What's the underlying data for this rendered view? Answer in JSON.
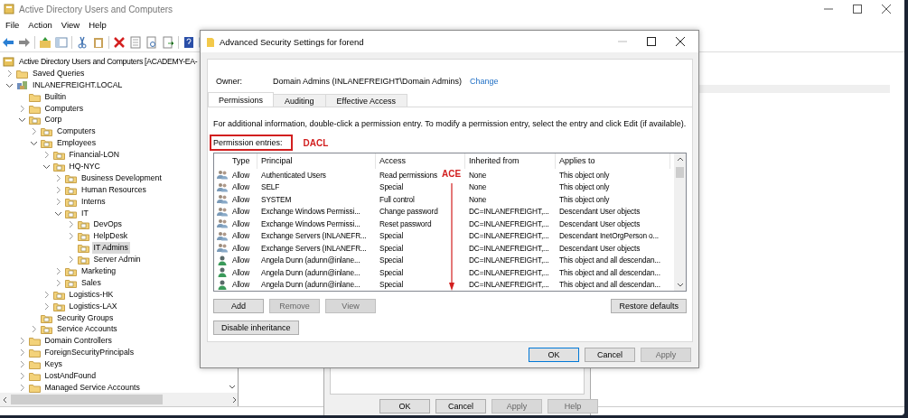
{
  "main_window": {
    "title": "Active Directory Users and Computers",
    "menu": [
      "File",
      "Action",
      "View",
      "Help"
    ],
    "tree": [
      {
        "kind": "root",
        "label": "Active Directory Users and Computers [ACADEMY-EA-",
        "selected": false,
        "children": [
          {
            "kind": "container",
            "label": "Saved Queries",
            "expanded": false,
            "selected": false
          },
          {
            "kind": "domain",
            "label": "INLANEFREIGHT.LOCAL",
            "expanded": true,
            "selected": false,
            "children": [
              {
                "kind": "container",
                "label": "Builtin",
                "selected": false
              },
              {
                "kind": "container",
                "label": "Computers",
                "expanded": false,
                "selected": false
              },
              {
                "kind": "ou",
                "label": "Corp",
                "expanded": true,
                "selected": false,
                "children": [
                  {
                    "kind": "ou",
                    "label": "Computers",
                    "expanded": false,
                    "selected": false
                  },
                  {
                    "kind": "ou",
                    "label": "Employees",
                    "expanded": true,
                    "selected": false,
                    "children": [
                      {
                        "kind": "ou",
                        "label": "Financial-LON",
                        "expanded": false,
                        "selected": false
                      },
                      {
                        "kind": "ou",
                        "label": "HQ-NYC",
                        "expanded": true,
                        "selected": false,
                        "children": [
                          {
                            "kind": "ou",
                            "label": "Business Development",
                            "expanded": false,
                            "selected": false
                          },
                          {
                            "kind": "ou",
                            "label": "Human Resources",
                            "expanded": false,
                            "selected": false
                          },
                          {
                            "kind": "ou",
                            "label": "Interns",
                            "expanded": false,
                            "selected": false
                          },
                          {
                            "kind": "ou",
                            "label": "IT",
                            "expanded": true,
                            "selected": false,
                            "children": [
                              {
                                "kind": "ou",
                                "label": "DevOps",
                                "expanded": false,
                                "selected": false
                              },
                              {
                                "kind": "ou",
                                "label": "HelpDesk",
                                "expanded": false,
                                "selected": false
                              },
                              {
                                "kind": "ou",
                                "label": "IT Admins",
                                "selected": true
                              },
                              {
                                "kind": "ou",
                                "label": "Server Admin",
                                "expanded": false,
                                "selected": false
                              }
                            ]
                          },
                          {
                            "kind": "ou",
                            "label": "Marketing",
                            "expanded": false,
                            "selected": false
                          },
                          {
                            "kind": "ou",
                            "label": "Sales",
                            "expanded": false,
                            "selected": false
                          }
                        ]
                      },
                      {
                        "kind": "ou",
                        "label": "Logistics-HK",
                        "expanded": false,
                        "selected": false
                      },
                      {
                        "kind": "ou",
                        "label": "Logistics-LAX",
                        "expanded": false,
                        "selected": false
                      }
                    ]
                  },
                  {
                    "kind": "ou",
                    "label": "Security Groups",
                    "selected": false
                  },
                  {
                    "kind": "ou",
                    "label": "Service Accounts",
                    "expanded": false,
                    "selected": false
                  }
                ]
              },
              {
                "kind": "container",
                "label": "Domain Controllers",
                "expanded": false,
                "selected": false
              },
              {
                "kind": "container",
                "label": "ForeignSecurityPrincipals",
                "expanded": false,
                "selected": false
              },
              {
                "kind": "container",
                "label": "Keys",
                "expanded": false,
                "selected": false
              },
              {
                "kind": "container",
                "label": "LostAndFound",
                "expanded": false,
                "selected": false
              },
              {
                "kind": "container",
                "label": "Managed Service Accounts",
                "expanded": false,
                "selected": false
              }
            ]
          }
        ]
      }
    ]
  },
  "properties_dialog": {
    "buttons": [
      {
        "label": "OK",
        "disabled": false
      },
      {
        "label": "Cancel",
        "disabled": false
      },
      {
        "label": "Apply",
        "disabled": true
      },
      {
        "label": "Help",
        "disabled": true
      }
    ]
  },
  "dialog": {
    "title": "Advanced Security Settings for forend",
    "owner_label": "Owner:",
    "owner": "Domain Admins (INLANEFREIGHT\\Domain Admins)",
    "owner_link": "Change",
    "tabs": [
      {
        "label": "Permissions",
        "selected": true
      },
      {
        "label": "Auditing",
        "selected": false
      },
      {
        "label": "Effective Access",
        "selected": false
      }
    ],
    "info": "For additional information, double-click a permission entry. To modify a permission entry, select the entry and click Edit (if available).",
    "entries_label": "Permission entries:",
    "entries_label_highlighted": true,
    "dacl_annotation": "DACL",
    "ace_annotation": "ACE",
    "columns": [
      "Type",
      "Principal",
      "Access",
      "Inherited from",
      "Applies to"
    ],
    "rows": [
      {
        "kind": "group",
        "type": "Allow",
        "principal": "Authenticated Users",
        "access": "Read permissions",
        "inherited_from": "None",
        "applies_to": "This object only"
      },
      {
        "kind": "group",
        "type": "Allow",
        "principal": "SELF",
        "access": "Special",
        "inherited_from": "None",
        "applies_to": "This object only"
      },
      {
        "kind": "group",
        "type": "Allow",
        "principal": "SYSTEM",
        "access": "Full control",
        "inherited_from": "None",
        "applies_to": "This object only"
      },
      {
        "kind": "group",
        "type": "Allow",
        "principal": "Exchange Windows Permissi...",
        "access": "Change password",
        "inherited_from": "DC=INLANEFREIGHT,...",
        "applies_to": "Descendant User objects"
      },
      {
        "kind": "group",
        "type": "Allow",
        "principal": "Exchange Windows Permissi...",
        "access": "Reset password",
        "inherited_from": "DC=INLANEFREIGHT,...",
        "applies_to": "Descendant User objects"
      },
      {
        "kind": "group",
        "type": "Allow",
        "principal": "Exchange Servers (INLANEFR...",
        "access": "Special",
        "inherited_from": "DC=INLANEFREIGHT,...",
        "applies_to": "Descendant InetOrgPerson o..."
      },
      {
        "kind": "group",
        "type": "Allow",
        "principal": "Exchange Servers (INLANEFR...",
        "access": "Special",
        "inherited_from": "DC=INLANEFREIGHT,...",
        "applies_to": "Descendant User objects"
      },
      {
        "kind": "user",
        "type": "Allow",
        "principal": "Angela Dunn (adunn@inlane...",
        "access": "Special",
        "inherited_from": "DC=INLANEFREIGHT,...",
        "applies_to": "This object and all descendan..."
      },
      {
        "kind": "user",
        "type": "Allow",
        "principal": "Angela Dunn (adunn@inlane...",
        "access": "Special",
        "inherited_from": "DC=INLANEFREIGHT,...",
        "applies_to": "This object and all descendan..."
      },
      {
        "kind": "user",
        "type": "Allow",
        "principal": "Angela Dunn (adunn@inlane...",
        "access": "Special",
        "inherited_from": "DC=INLANEFREIGHT,...",
        "applies_to": "This object and all descendan..."
      }
    ],
    "list_buttons": [
      {
        "label": "Add",
        "disabled": false
      },
      {
        "label": "Remove",
        "disabled": true
      },
      {
        "label": "View",
        "disabled": true
      }
    ],
    "restore_button": "Restore defaults",
    "inheritance_button": "Disable inheritance",
    "buttons": [
      {
        "label": "OK",
        "disabled": false,
        "default": true
      },
      {
        "label": "Cancel",
        "disabled": false,
        "default": false
      },
      {
        "label": "Apply",
        "disabled": true,
        "default": false
      }
    ]
  }
}
